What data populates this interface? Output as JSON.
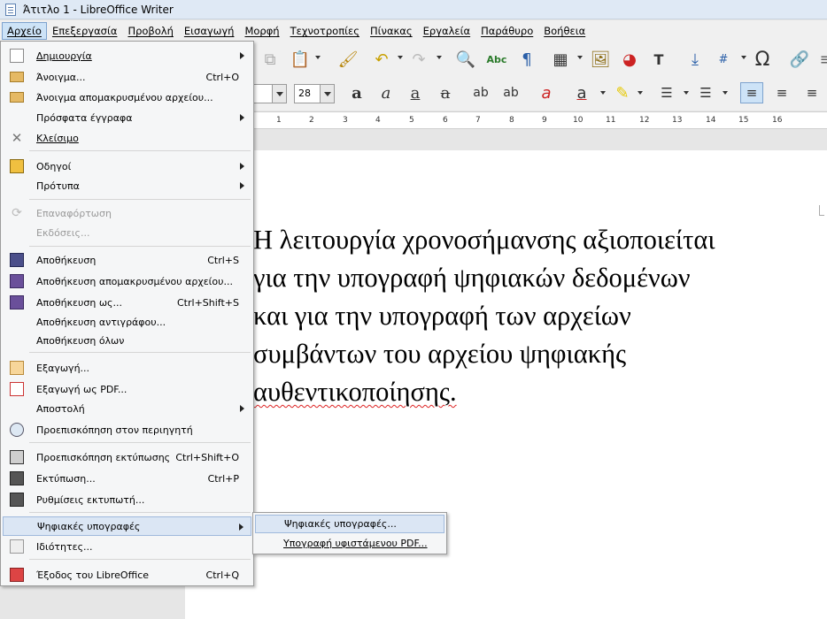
{
  "window": {
    "title": "Άτιτλο 1 - LibreOffice Writer"
  },
  "menubar": [
    "Αρχείο",
    "Επεξεργασία",
    "Προβολή",
    "Εισαγωγή",
    "Μορφή",
    "Τεχνοτροπίες",
    "Πίνακας",
    "Εργαλεία",
    "Παράθυρο",
    "Βοήθεια"
  ],
  "file_menu": {
    "new": "Δημιουργία",
    "open": "Άνοιγμα...",
    "open_shortcut": "Ctrl+O",
    "open_remote": "Άνοιγμα απομακρυσμένου αρχείου...",
    "recent": "Πρόσφατα έγγραφα",
    "close": "Κλείσιμο",
    "wizards": "Οδηγοί",
    "templates": "Πρότυπα",
    "reload": "Επαναφόρτωση",
    "versions": "Εκδόσεις...",
    "save": "Αποθήκευση",
    "save_shortcut": "Ctrl+S",
    "save_remote": "Αποθήκευση απομακρυσμένου αρχείου...",
    "save_as": "Αποθήκευση ως...",
    "save_as_shortcut": "Ctrl+Shift+S",
    "save_copy": "Αποθήκευση αντιγράφου...",
    "save_all": "Αποθήκευση όλων",
    "export": "Εξαγωγή...",
    "export_pdf": "Εξαγωγή ως PDF...",
    "send": "Αποστολή",
    "preview_browser": "Προεπισκόπηση στον περιηγητή",
    "print_preview": "Προεπισκόπηση εκτύπωσης",
    "print_preview_shortcut": "Ctrl+Shift+O",
    "print": "Εκτύπωση...",
    "print_shortcut": "Ctrl+P",
    "printer_settings": "Ρυθμίσεις εκτυπωτή...",
    "digital_signatures": "Ψηφιακές υπογραφές",
    "properties": "Ιδιότητες...",
    "exit": "Έξοδος του LibreOffice",
    "exit_shortcut": "Ctrl+Q"
  },
  "submenu": {
    "signatures": "Ψηφιακές υπογραφές...",
    "sign_pdf": "Υπογραφή υφιστάμενου PDF..."
  },
  "toolbar": {
    "font_size": "28"
  },
  "ruler": [
    "1",
    "2",
    "3",
    "4",
    "5",
    "6",
    "7",
    "8",
    "9",
    "10",
    "11",
    "12",
    "13",
    "14",
    "15",
    "16"
  ],
  "document": {
    "lines": [
      "Η λειτουργία χρονοσήμανσης αξιοποιείται",
      "για την υπογραφή ψηφιακών δεδομένων",
      "και για την υπογραφή των αρχείων",
      "συμβάντων του αρχείου ψηφιακής",
      "αυθεντικοποίησης."
    ]
  },
  "colors": {
    "menu_bg": "#f5f6f7",
    "highlight": "#dbe6f4",
    "titlebar": "#dfe9f5"
  }
}
